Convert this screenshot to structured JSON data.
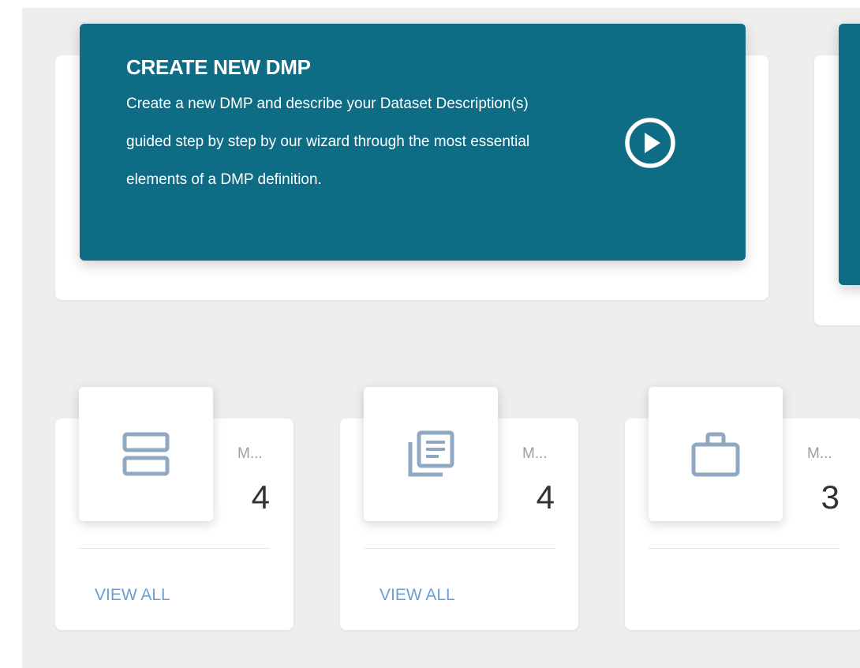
{
  "hero": {
    "title": "CREATE NEW DMP",
    "description": "Create a new DMP and describe your Dataset Description(s) guided step by step by our wizard through the most essential elements of a DMP definition.",
    "action_icon": "play-circle-icon"
  },
  "stats": [
    {
      "icon": "storage-icon",
      "label": "M...",
      "count": "4",
      "link": "VIEW ALL"
    },
    {
      "icon": "library-books-icon",
      "label": "M...",
      "count": "4",
      "link": "VIEW ALL"
    },
    {
      "icon": "briefcase-icon",
      "label": "M...",
      "count": "3",
      "link": ""
    }
  ],
  "colors": {
    "accent": "#0e6c85",
    "icon": "#8fa9c2",
    "link": "#6d9fd1",
    "background": "#eeeeee"
  }
}
